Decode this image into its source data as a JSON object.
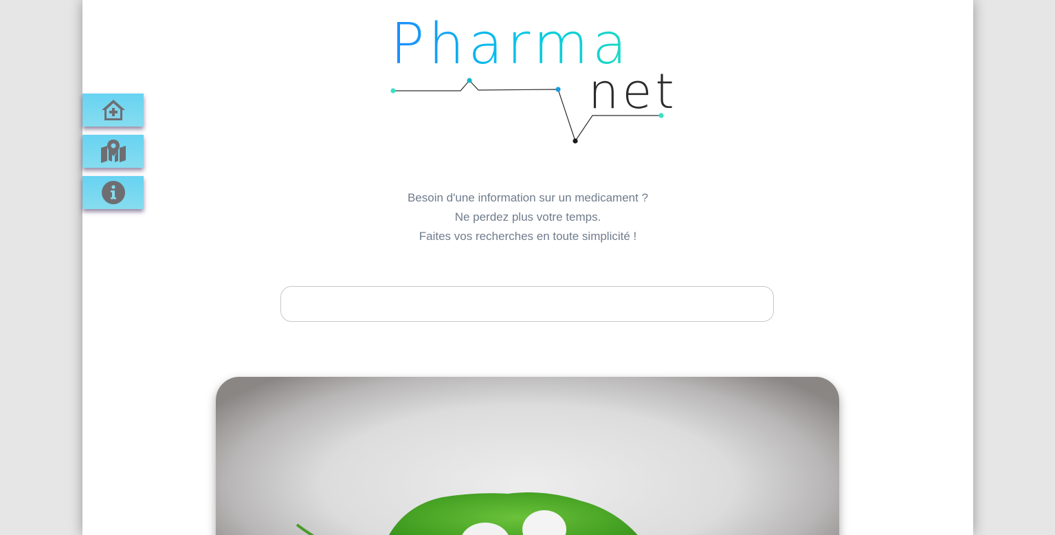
{
  "brand": {
    "word1": "Pharma",
    "word2": "net"
  },
  "tagline": {
    "line1": "Besoin d'une information sur un medicament ?",
    "line2": "Ne perdez plus votre temps.",
    "line3": "Faites vos recherches en toute simplicité !"
  },
  "search": {
    "value": "",
    "placeholder": ""
  },
  "sidebar": {
    "items": [
      {
        "icon": "home-medical-icon"
      },
      {
        "icon": "map-marker-icon"
      },
      {
        "icon": "info-icon"
      }
    ]
  },
  "colors": {
    "background": "#e6e6e6",
    "page": "#ffffff",
    "accent_blue": "#1d8cff",
    "accent_teal": "#1fd9c2",
    "sidebar_button": "#67d3f2",
    "icon_grey": "#6e6e72",
    "text": "#6f7b8c"
  }
}
